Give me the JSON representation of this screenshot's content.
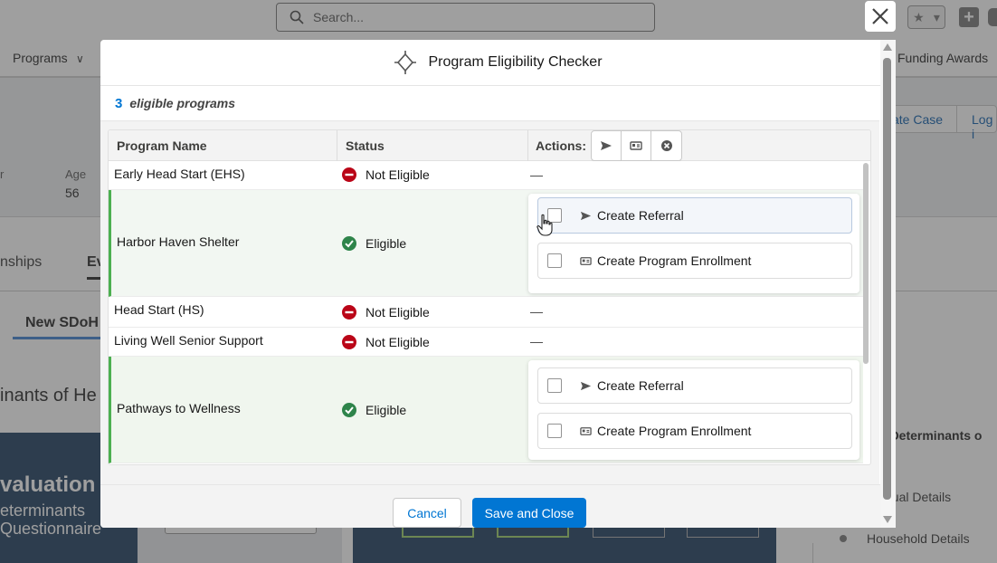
{
  "background": {
    "search_placeholder": "Search...",
    "nav_programs": "Programs",
    "nav_funding": "Funding Awards",
    "header_btn_create_case": "ate Case",
    "header_btn_log": "Log i",
    "field_left_label": "r",
    "field_age_label": "Age",
    "field_age_value": "56",
    "tab_relationships": "nships",
    "tab_ev": "Ev",
    "subtab_new_sdoh": "New SDoH",
    "section_heading": "inants of He",
    "eval_title": "valuation",
    "eval_sub1": "eterminants",
    "eval_sub2": "Questionnaire",
    "right_title": "al Determinants o",
    "right_item1": "dual Details",
    "right_item2": "Household Details"
  },
  "modal": {
    "title": "Program Eligibility Checker",
    "summary_count": "3",
    "summary_label": "eligible programs",
    "columns": {
      "program_name": "Program Name",
      "status": "Status",
      "actions": "Actions:"
    },
    "rows": [
      {
        "name": "Early Head Start (EHS)",
        "status": "Not Eligible",
        "eligible": false,
        "action_placeholder": "—"
      },
      {
        "name": "Harbor Haven Shelter",
        "status": "Eligible",
        "eligible": true,
        "actions": [
          "Create Referral",
          "Create Program Enrollment"
        ]
      },
      {
        "name": "Head Start (HS)",
        "status": "Not Eligible",
        "eligible": false,
        "action_placeholder": "—"
      },
      {
        "name": "Living Well Senior Support",
        "status": "Not Eligible",
        "eligible": false,
        "action_placeholder": "—"
      },
      {
        "name": "Pathways to Wellness",
        "status": "Eligible",
        "eligible": true,
        "actions": [
          "Create Referral",
          "Create Program Enrollment"
        ]
      }
    ],
    "footer": {
      "cancel_label": "Cancel",
      "save_label": "Save and Close"
    }
  },
  "colors": {
    "accent": "#0176d3",
    "eligible_green": "#2e844a",
    "not_eligible_red": "#ba0517",
    "eligible_row_border": "#4caf50"
  }
}
